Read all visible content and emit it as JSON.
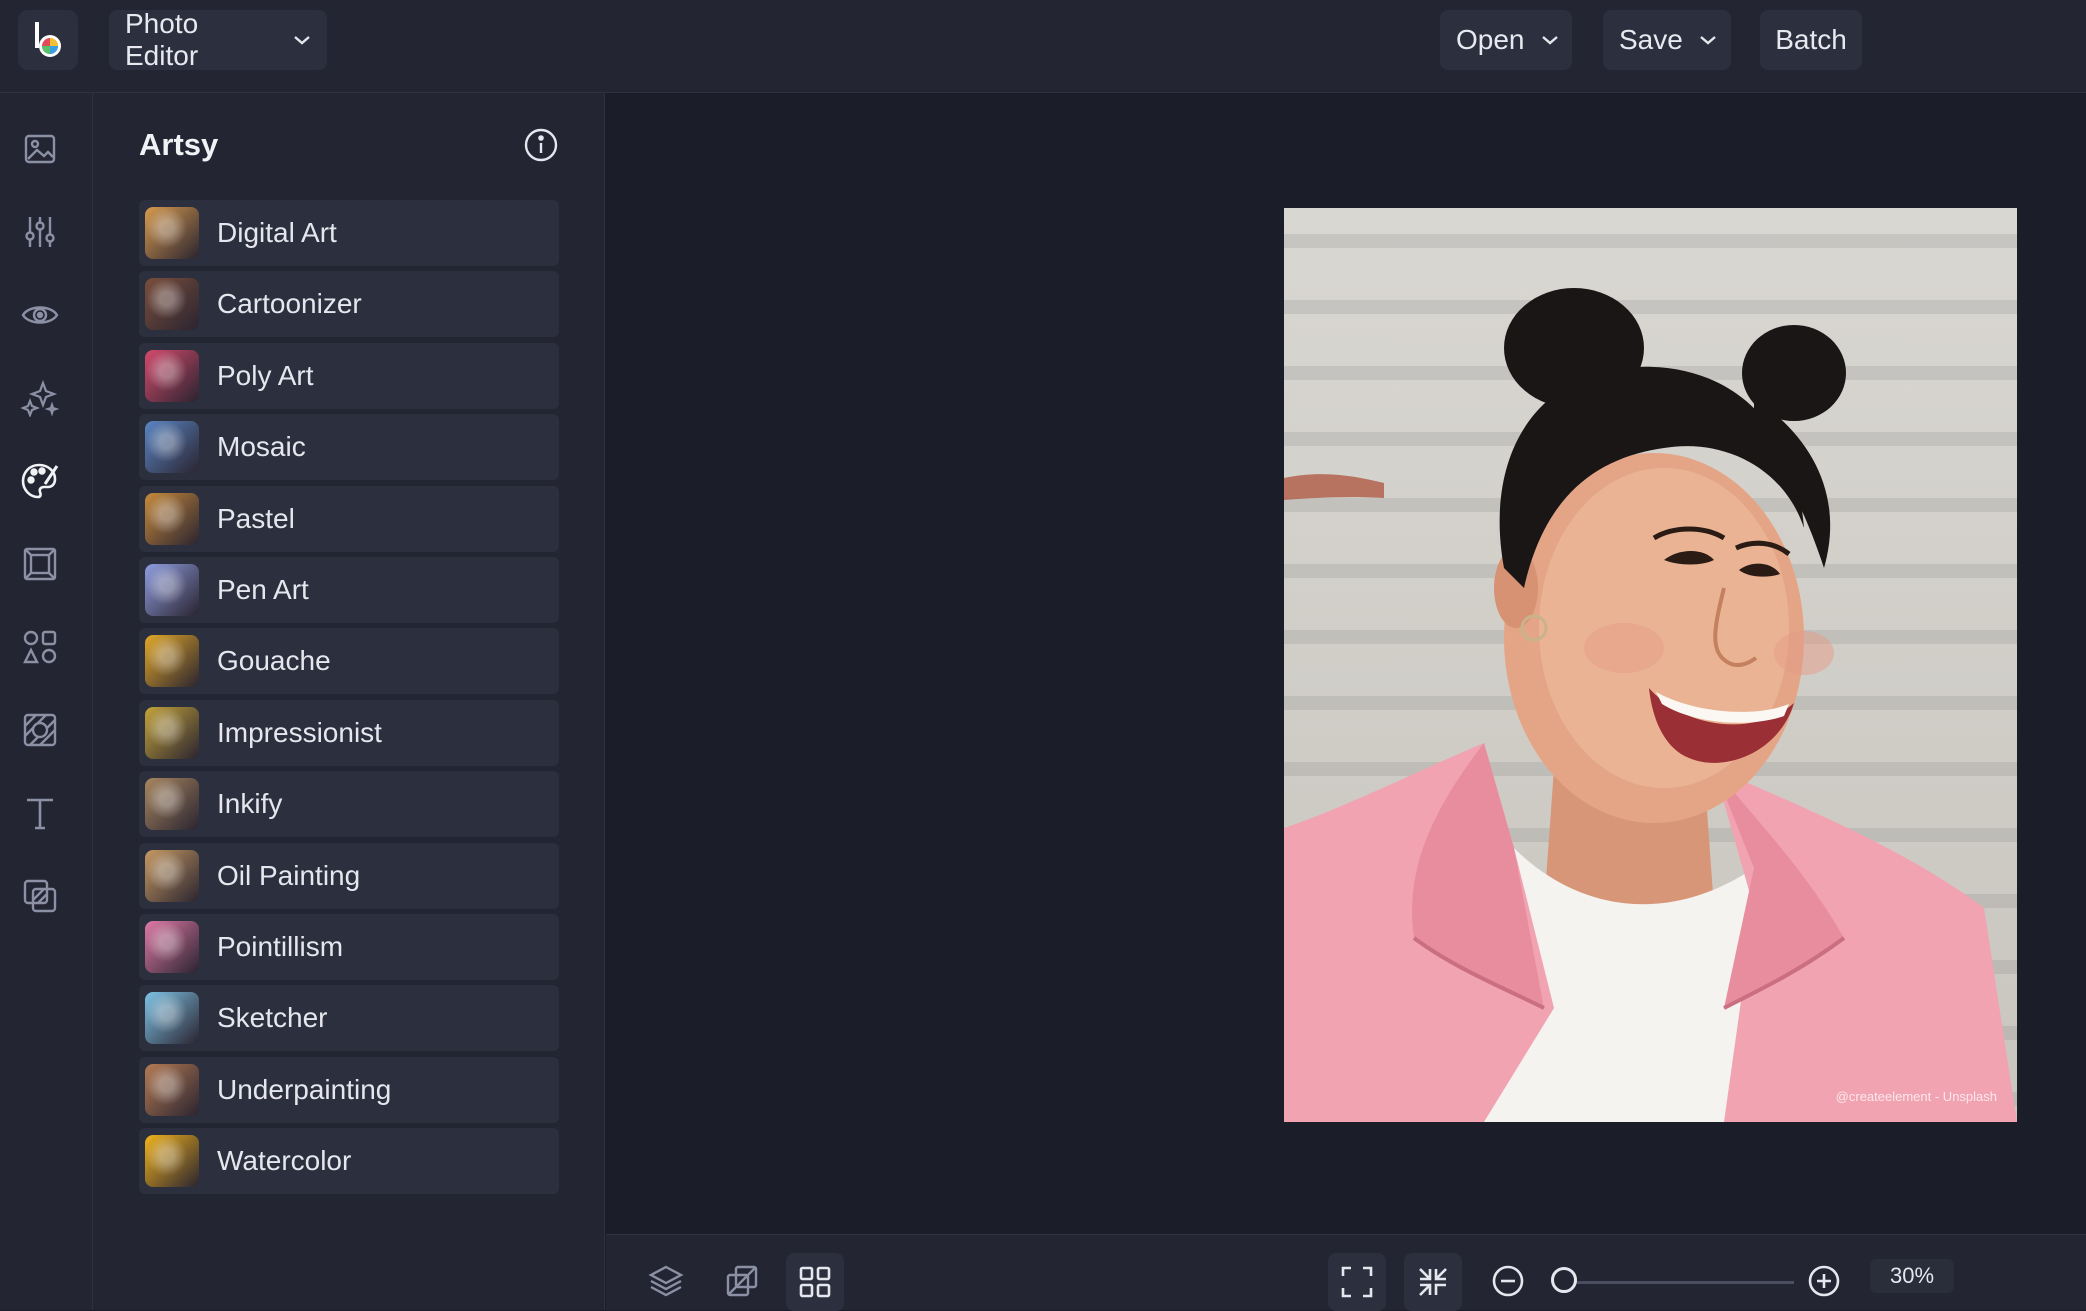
{
  "topbar": {
    "app_menu": "Photo Editor",
    "open": "Open",
    "save": "Save",
    "batch": "Batch"
  },
  "rail": {
    "icons": [
      "image-icon",
      "sliders-icon",
      "eye-icon",
      "sparkles-icon",
      "palette-icon",
      "frame-icon",
      "shapes-icon",
      "texture-icon",
      "text-icon",
      "overlay-icon"
    ],
    "active": "palette-icon"
  },
  "panel": {
    "title": "Artsy",
    "items": [
      {
        "label": "Digital Art",
        "color": "#d89b4e"
      },
      {
        "label": "Cartoonizer",
        "color": "#7a4f3c"
      },
      {
        "label": "Poly Art",
        "color": "#d54a6c"
      },
      {
        "label": "Mosaic",
        "color": "#5b86c4"
      },
      {
        "label": "Pastel",
        "color": "#c88a3b"
      },
      {
        "label": "Pen Art",
        "color": "#8f9de0"
      },
      {
        "label": "Gouache",
        "color": "#e3a827"
      },
      {
        "label": "Impressionist",
        "color": "#c4a43a"
      },
      {
        "label": "Inkify",
        "color": "#a88760"
      },
      {
        "label": "Oil Painting",
        "color": "#c79a62"
      },
      {
        "label": "Pointillism",
        "color": "#e079a6"
      },
      {
        "label": "Sketcher",
        "color": "#7ec3e6"
      },
      {
        "label": "Underpainting",
        "color": "#b57b54"
      },
      {
        "label": "Watercolor",
        "color": "#f2b31c"
      }
    ]
  },
  "canvas": {
    "photo_credit": "@createelement - Unsplash"
  },
  "bottombar": {
    "zoom_label": "30%",
    "zoom_level": 0.3
  },
  "colors": {
    "background": "#1b1d28",
    "panel": "#232533",
    "button": "#2c2f3d",
    "jacket": "#f2a6b4"
  }
}
